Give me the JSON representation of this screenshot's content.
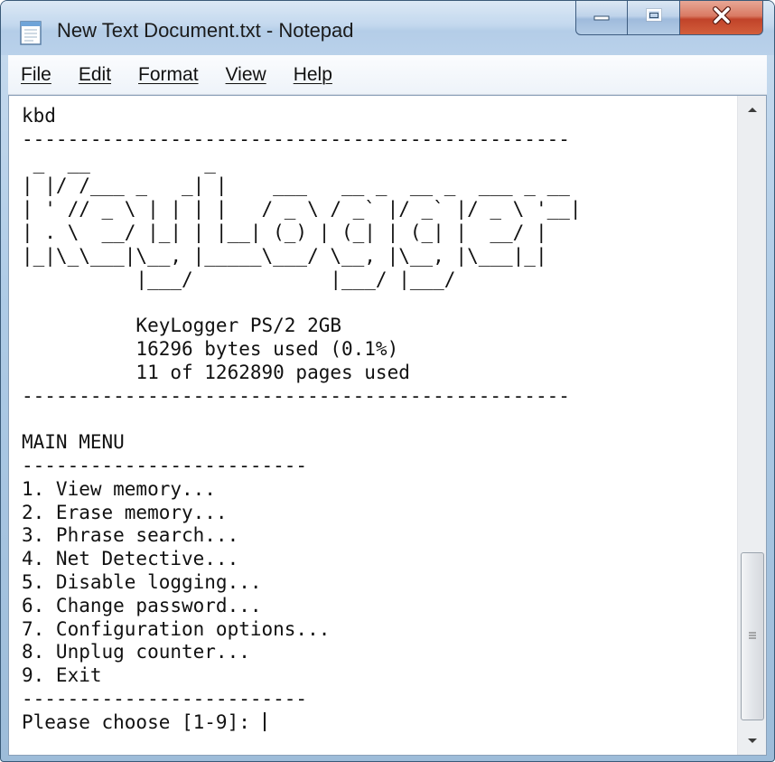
{
  "window": {
    "title": "New Text Document.txt - Notepad"
  },
  "icons": {
    "app": "notepad-icon",
    "minimize": "minimize-icon",
    "maximize": "maximize-icon",
    "close": "close-icon",
    "scroll_up": "scroll-up-arrow-icon",
    "scroll_down": "scroll-down-arrow-icon",
    "grip": "scroll-grip-icon"
  },
  "colors": {
    "close_button": "#c1432a",
    "title_bar": "#c3d8ee"
  },
  "menu": {
    "items": [
      {
        "label": "File"
      },
      {
        "label": "Edit"
      },
      {
        "label": "Format"
      },
      {
        "label": "View"
      },
      {
        "label": "Help"
      }
    ]
  },
  "document": {
    "header": "kbd\n------------------------------------------------",
    "banner": " _  __          _\n| |/ /___ _   _| |    ___   __ _  __ _  ___ _ __\n| ' // _ \\ | | | |   / _ \\ / _` |/ _` |/ _ \\ '__|\n| . \\  __/ |_| | |__| (_) | (_| | (_| |  __/ |\n|_|\\_\\___|\\__, |_____\\___/ \\__, |\\__, |\\___|_|\n          |___/            |___/ |___/",
    "info": "\n          KeyLogger PS/2 2GB\n          16296 bytes used (0.1%)\n          11 of 1262890 pages used\n------------------------------------------------\n",
    "menu_block": "MAIN MENU\n-------------------------\n1. View memory...\n2. Erase memory...\n3. Phrase search...\n4. Net Detective...\n5. Disable logging...\n6. Change password...\n7. Configuration options...\n8. Unplug counter...\n9. Exit\n-------------------------",
    "prompt": "Please choose [1-9]: "
  }
}
